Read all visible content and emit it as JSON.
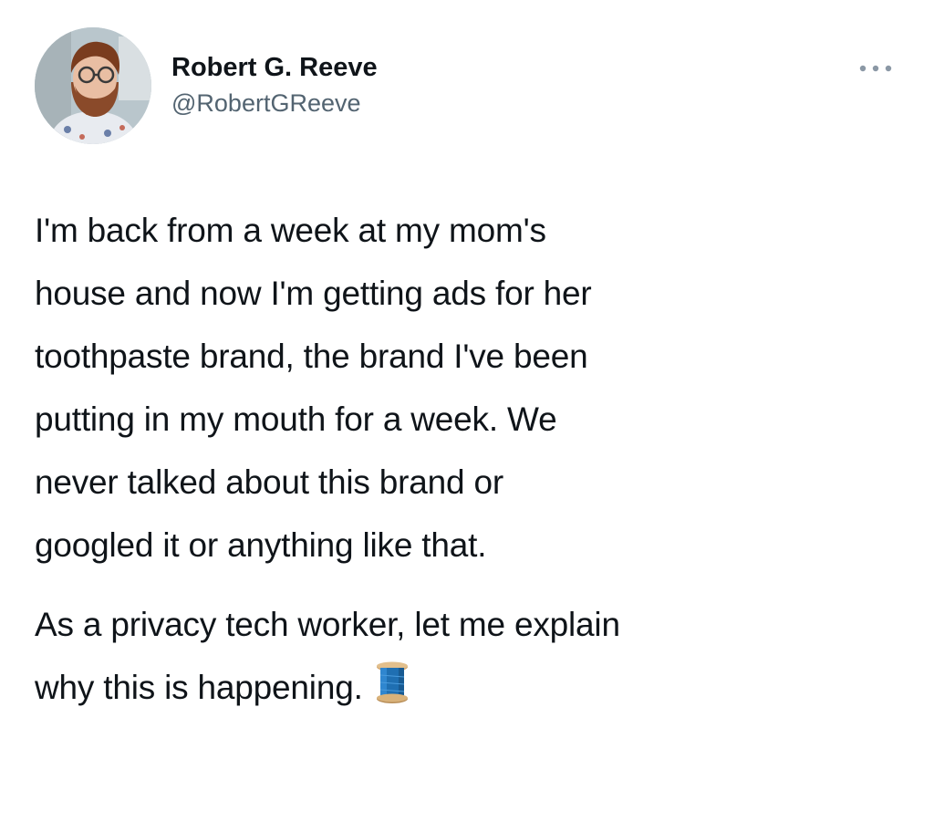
{
  "tweet": {
    "author": {
      "display_name": "Robert G. Reeve",
      "handle": "@RobertGReeve",
      "avatar_icon": "user-avatar-photo"
    },
    "more_icon": "ellipsis-icon",
    "paragraphs": [
      "I'm back from a week at my mom's\nhouse and now I'm getting ads for her\ntoothpaste brand, the brand I've been\nputting in my mouth for a week. We\nnever talked about this brand or\ngoogled it or anything like that.",
      "As a privacy tech worker, let me explain\nwhy this is happening."
    ],
    "thread_emoji_icon": "thread-spool-icon"
  },
  "colors": {
    "text": "#0f1419",
    "secondary": "#536471",
    "spool_blue": "#1f6fb2",
    "spool_wood": "#d9b27a"
  }
}
